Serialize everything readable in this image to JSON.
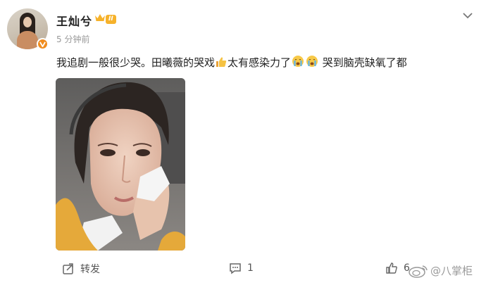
{
  "post": {
    "author": "王灿兮",
    "level_badge": "II",
    "time": "5 分钟前",
    "text_part1": "我追剧一般很少哭。田曦薇的哭戏",
    "text_part2": "太有感染力了",
    "text_part3": " 哭到脑壳缺氧了都",
    "emojis": [
      "thumbs-up-icon",
      "crying-face-icon",
      "crying-face-icon"
    ]
  },
  "actions": {
    "repost_label": "转发",
    "comment_count": "1",
    "like_count": "6"
  },
  "watermark": {
    "text": "八掌柜"
  },
  "colors": {
    "verify": "#f08c1e",
    "badge": "#f6b22b",
    "hair": "#2a211c",
    "sweater": "#e5a93a"
  }
}
